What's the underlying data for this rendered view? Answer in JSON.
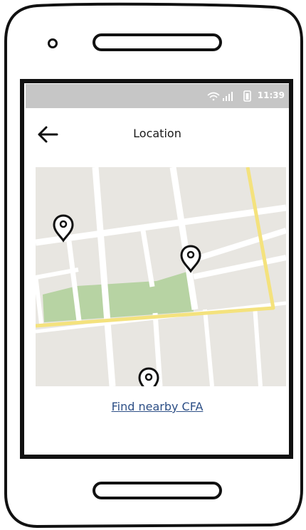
{
  "status_bar": {
    "time": "11:39"
  },
  "header": {
    "title": "Location"
  },
  "link": {
    "label": "Find nearby CFA"
  },
  "icons": {
    "back": "arrow-left-icon",
    "pins": [
      "map-pin-icon",
      "map-pin-icon",
      "map-pin-icon"
    ],
    "wifi": "wifi-icon",
    "signal": "signal-icon",
    "battery": "battery-icon"
  },
  "colors": {
    "status_bar": "#c6c6c6",
    "map_background": "#e8e6e1",
    "map_roads": "#ffffff",
    "highlight_road": "#f4e27d",
    "park": "#b7d3a3",
    "link": "#2d4f86"
  }
}
